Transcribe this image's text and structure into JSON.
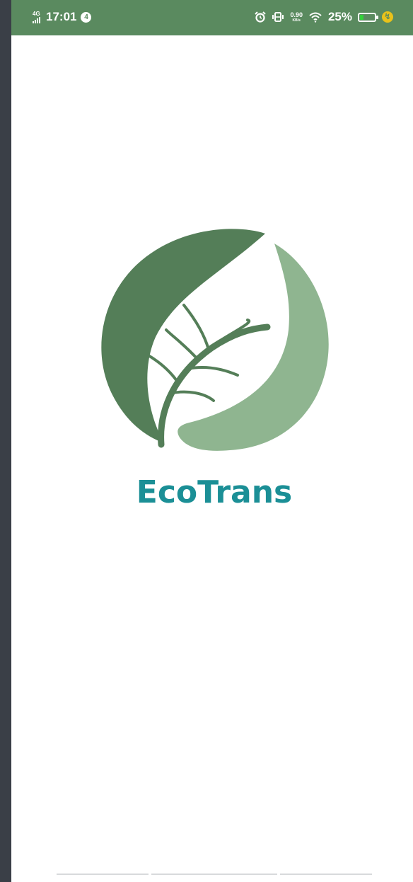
{
  "status_bar": {
    "network": "4G",
    "time": "17:01",
    "notification_count": "4",
    "speed_value": "0.90",
    "speed_unit": "KB/s",
    "battery_percent": "25%",
    "battery_level": 0.25,
    "icons": [
      "alarm-icon",
      "vibrate-icon",
      "wifi-icon",
      "battery-icon",
      "charging-icon"
    ]
  },
  "splash": {
    "app_name": "EcoTrans",
    "logo_colors": {
      "dark_leaf": "#547e58",
      "light_leaf": "#8fb590"
    },
    "name_color": "#1b8f96"
  }
}
